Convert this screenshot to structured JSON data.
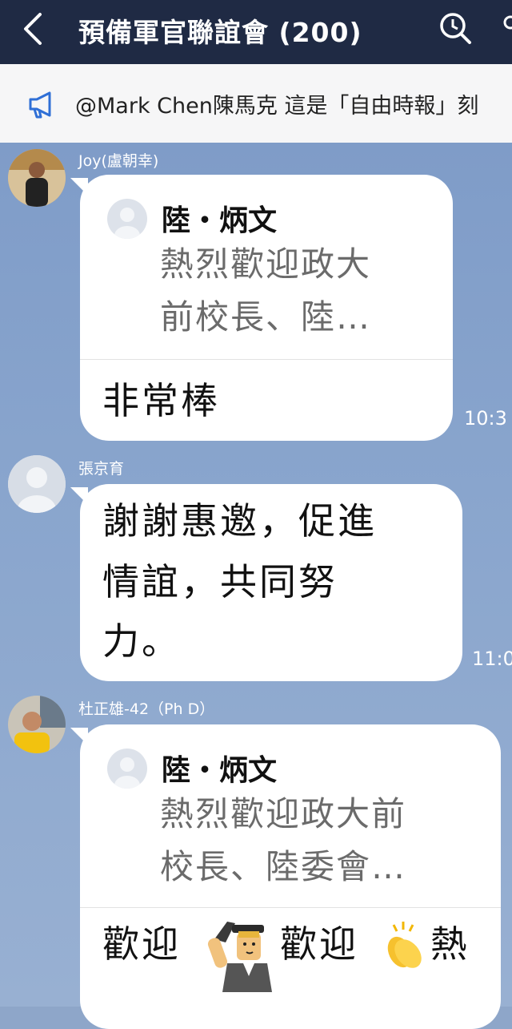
{
  "header": {
    "title": "預備軍官聯誼會 (200)",
    "icons": [
      "back-icon",
      "search-icon",
      "more-icon"
    ]
  },
  "announcement": {
    "icon": "megaphone-icon",
    "text": "@Mark Chen陳馬克 這是「自由時報」刻"
  },
  "messages": [
    {
      "sender": "Joy(盧朝幸)",
      "quote": {
        "name": "陸・炳文",
        "line1": "熱烈歡迎政大",
        "line2": "前校長、陸…"
      },
      "text": "非常棒",
      "time": "10:3"
    },
    {
      "sender": "張京育",
      "lines": [
        "謝謝惠邀，促進",
        "情誼，共同努",
        "力。"
      ],
      "time": "11:0"
    },
    {
      "sender": "杜正雄-42（Ph D）",
      "quote": {
        "name": "陸・炳文",
        "line1": "熱烈歡迎政大前",
        "line2": "校長、陸委會…"
      },
      "text_parts": [
        "歡迎",
        "歡迎",
        "熱"
      ]
    }
  ],
  "colors": {
    "header_bg": "#1f2a44",
    "chat_bg": "#8ea6c9",
    "bubble_bg": "#ffffff"
  }
}
